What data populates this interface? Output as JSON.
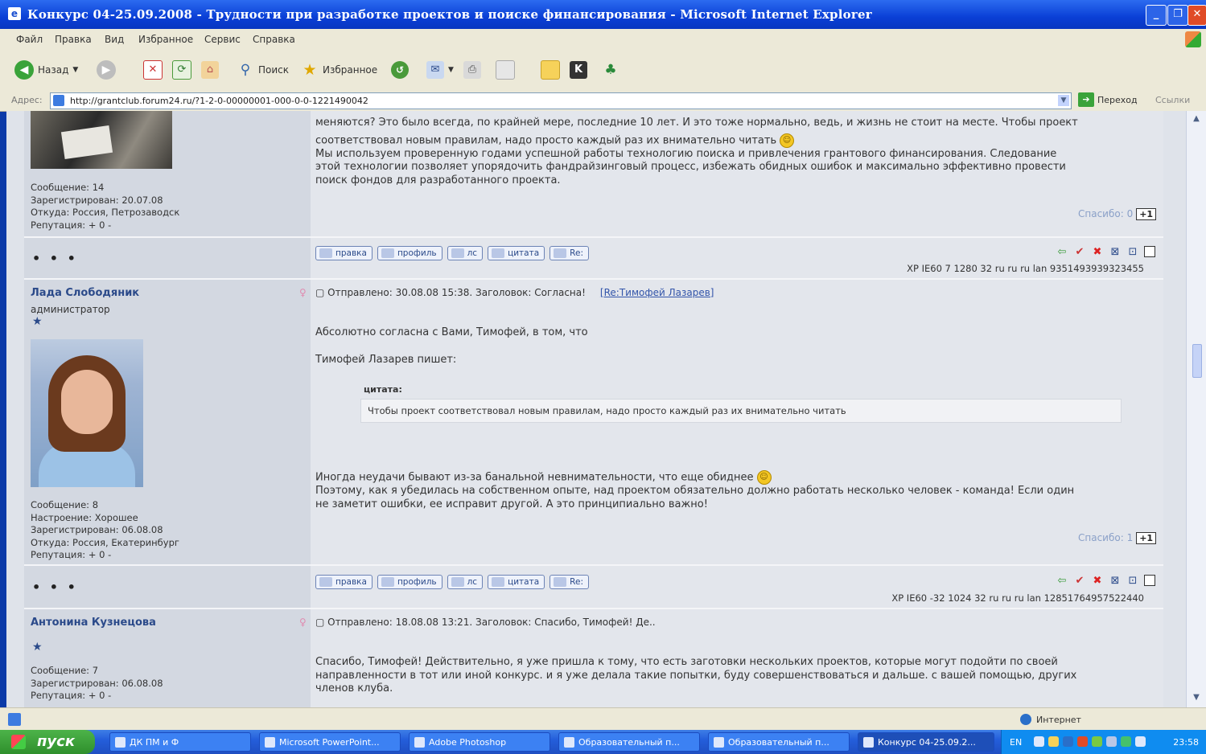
{
  "window": {
    "title": "Конкурс 04-25.09.2008 - Трудности при разработке проектов и поиске финансирования - Microsoft Internet Explorer"
  },
  "menu": [
    "Файл",
    "Правка",
    "Вид",
    "Избранное",
    "Сервис",
    "Справка"
  ],
  "toolbar": {
    "back": "Назад",
    "search": "Поиск",
    "favorites": "Избранное"
  },
  "address": {
    "label": "Адрес:",
    "url": "http://grantclub.forum24.ru/?1-2-0-00000001-000-0-0-1221490042",
    "go": "Переход",
    "links": "Ссылки"
  },
  "post1": {
    "msg_line1": "меняются? Это было всегда, по крайней мере, последние 10 лет. И это тоже нормально, ведь, и жизнь не стоит на месте. Чтобы проект",
    "msg_line2": "соответствовал новым правилам, надо просто каждый раз их внимательно читать",
    "msg_line3": "Мы используем проверенную годами успешной работы технологию поиска и привлечения грантового финансирования. Следование",
    "msg_line4": "этой технологии позволяет упорядочить фандрайзинговый процесс, избежать обидных ошибок и максимально эффективно провести",
    "msg_line5": "поиск фондов для разработанного проекта.",
    "meta_messages": "Сообщение: 14",
    "meta_registered": "Зарегистрирован: 20.07.08",
    "meta_from": "Откуда: Россия, Петрозаводск",
    "meta_rep": "Репутация: + 0 -",
    "thanks": "Спасибо: 0",
    "sysinfo": "XP IE60 7 1280 32 ru ru ru lan 9351493939323455"
  },
  "post2": {
    "author": "Лада Слободяник",
    "rank": "администратор",
    "header": "Отправлено: 30.08.08 15:38. Заголовок: Согласна!",
    "reply_link": "[Re:Тимофей Лазарев]",
    "line1": "Абсолютно согласна с Вами, Тимофей, в том, что",
    "line2": "Тимофей Лазарев пишет:",
    "quote_label": "цитата:",
    "quote": "Чтобы проект соответствовал новым правилам, надо просто каждый раз их внимательно читать",
    "line3": "Иногда неудачи бывают из-за банальной невнимательности, что еще обиднее",
    "line4": "Поэтому, как я убедилась на собственном опыте, над проектом обязательно должно работать несколько человек - команда! Если один",
    "line5": "не заметит ошибки, ее исправит другой. А это принципиально важно!",
    "meta_messages": "Сообщение: 8",
    "meta_mood": "Настроение: Хорошее",
    "meta_registered": "Зарегистрирован: 06.08.08",
    "meta_from": "Откуда: Россия, Екатеринбург",
    "meta_rep": "Репутация: + 0 -",
    "thanks": "Спасибо: 1",
    "sysinfo": "XP IE60 -32 1024 32 ru ru ru lan 12851764957522440"
  },
  "post3": {
    "author": "Антонина Кузнецова",
    "header": "Отправлено: 18.08.08 13:21. Заголовок: Спасибо, Тимофей! Де..",
    "line1": "Спасибо, Тимофей! Действительно, я уже пришла к тому, что есть заготовки нескольких проектов, которые могут подойти по своей",
    "line2": "направленности в тот или иной конкурс. и я уже делала такие попытки, буду совершенствоваться и дальше. с вашей помощью, других",
    "line3": "членов клуба.",
    "meta_messages": "Сообщение: 7",
    "meta_registered": "Зарегистрирован: 06.08.08",
    "meta_rep": "Репутация: + 0 -"
  },
  "post_buttons": [
    "правка",
    "профиль",
    "лс",
    "цитата",
    "Re:"
  ],
  "plus_one": "+1",
  "dots": "• • •",
  "statusbar": {
    "zone": "Интернет"
  },
  "taskbar": {
    "start": "пуск",
    "tasks": [
      "ДК ПМ и Ф",
      "Microsoft PowerPoint...",
      "Adobe Photoshop",
      "Образовательный п...",
      "Образовательный п...",
      "Конкурс 04-25.09.2..."
    ],
    "lang": "EN",
    "clock": "23:58"
  },
  "colors": {
    "title_bar": "#0a3fd6",
    "page_bg": "#dfe3ea",
    "username": "#2b4a8a",
    "taskbar": "#245edb",
    "start": "#2f8f2c"
  }
}
